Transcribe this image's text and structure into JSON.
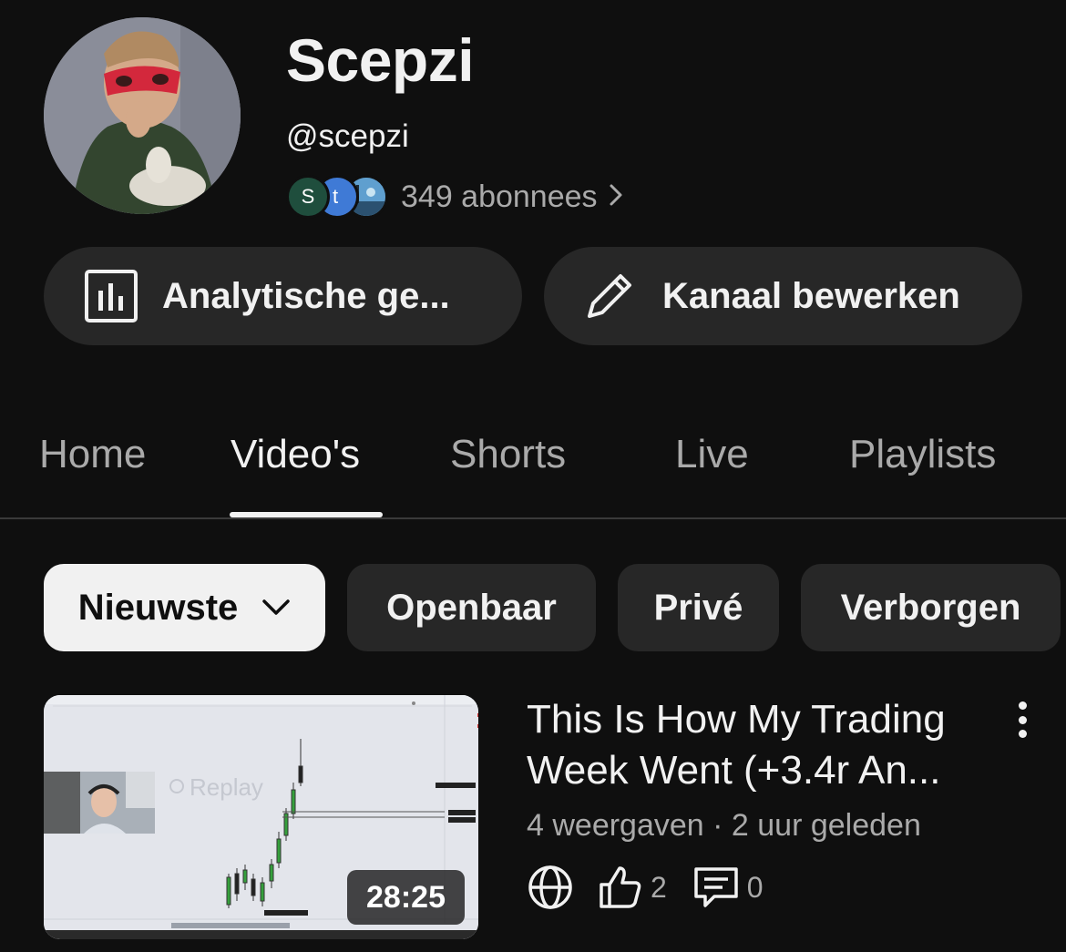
{
  "channel": {
    "name": "Scepzi",
    "handle": "@scepzi",
    "subscribers": "349 abonnees",
    "subscriber_avatars": [
      "S",
      "t",
      "landscape"
    ]
  },
  "actions": {
    "analytics_label": "Analytische ge...",
    "edit_label": "Kanaal bewerken"
  },
  "tabs": [
    {
      "label": "Home",
      "active": false
    },
    {
      "label": "Video's",
      "active": true
    },
    {
      "label": "Shorts",
      "active": false
    },
    {
      "label": "Live",
      "active": false
    },
    {
      "label": "Playlists",
      "active": false
    }
  ],
  "filters": [
    {
      "label": "Nieuwste",
      "selected": true
    },
    {
      "label": "Openbaar",
      "selected": false
    },
    {
      "label": "Privé",
      "selected": false
    },
    {
      "label": "Verborgen",
      "selected": false
    }
  ],
  "video": {
    "title": "This Is How My Trading Week Went (+3.4r An...",
    "meta": "4 weergaven · 2 uur geleden",
    "duration": "28:25",
    "likes": "2",
    "comments": "0",
    "visibility_icon": "globe-icon",
    "thumbnail_overlay_text": "Replay"
  },
  "colors": {
    "background": "#0f0f0f",
    "surface": "#272727",
    "text": "#f1f1f1",
    "muted": "#aaaaaa"
  }
}
